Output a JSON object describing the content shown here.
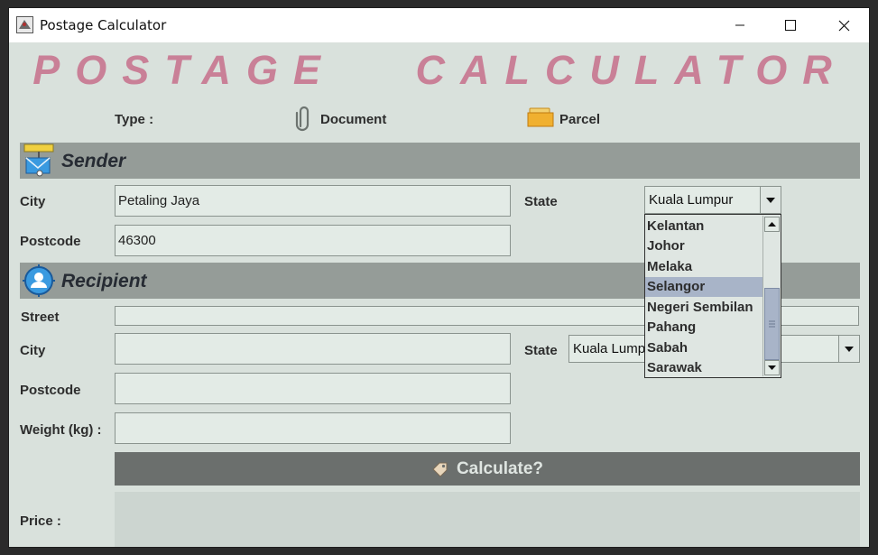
{
  "window": {
    "title": "Postage Calculator",
    "controls": {
      "minimize": "—",
      "maximize": "☐",
      "close": "✕"
    }
  },
  "banner": {
    "text": "POSTAGE   CALCULATOR"
  },
  "type_row": {
    "label": "Type :",
    "options": [
      {
        "label": "Document",
        "icon": "paperclip-icon"
      },
      {
        "label": "Parcel",
        "icon": "folder-icon"
      }
    ]
  },
  "sender": {
    "title": "Sender",
    "city_label": "City",
    "city_value": "Petaling Jaya",
    "state_label": "State",
    "state_value": "Kuala Lumpur",
    "postcode_label": "Postcode",
    "postcode_value": "46300"
  },
  "state_dropdown": {
    "options": [
      "Kelantan",
      "Johor",
      "Melaka",
      "Selangor",
      "Negeri Sembilan",
      "Pahang",
      "Sabah",
      "Sarawak"
    ],
    "highlighted": "Selangor"
  },
  "recipient": {
    "title": "Recipient",
    "street_label": "Street",
    "street_value": "",
    "city_label": "City",
    "city_value": "",
    "state_label": "State",
    "state_value": "Kuala Lumpur",
    "postcode_label": "Postcode",
    "postcode_value": "",
    "weight_label": "Weight (kg)  :",
    "weight_value": ""
  },
  "calculate": {
    "label": "Calculate?"
  },
  "price": {
    "label": "Price :",
    "value": ""
  },
  "colors": {
    "banner": "#c98097",
    "background": "#d9e1dc",
    "section_header": "#959c98",
    "button": "#6b6f6d",
    "selection": "#a8b4c8"
  }
}
